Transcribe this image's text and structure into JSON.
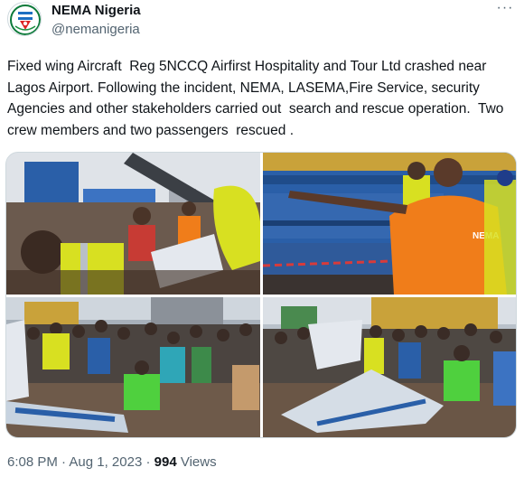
{
  "author": {
    "display_name": "NEMA Nigeria",
    "handle": "@nemanigeria",
    "avatar_icon": "nema-logo-icon"
  },
  "more_icon": "more-horizontal-icon",
  "more_label": "···",
  "tweet": {
    "text": "Fixed wing Aircraft  Reg 5NCCQ Airfirst Hospitality and Tour Ltd crashed near Lagos Airport. Following the incident, NEMA, LASEMA,Fire Service, security Agencies and other stakeholders carried out  search and rescue operation.  Two crew members and two passengers  rescued ."
  },
  "media": {
    "photos": [
      {
        "subject": "rescue workers in hi-vis vests at crane"
      },
      {
        "subject": "official in orange shirt pointing"
      },
      {
        "subject": "crowd around aircraft wreckage"
      },
      {
        "subject": "crowd at crash site with wreckage"
      }
    ],
    "vest_text": "NEMA",
    "colors": {
      "hiviz": "#d8e021",
      "orange_shirt": "#f07d1a",
      "truck_blue": "#2a5fa8",
      "green_shirt": "#4fd03e",
      "wreck_white": "#e4e8ee"
    }
  },
  "meta": {
    "time": "6:08 PM",
    "separator": "·",
    "date": "Aug 1, 2023",
    "views_count": "994",
    "views_label": "Views"
  }
}
